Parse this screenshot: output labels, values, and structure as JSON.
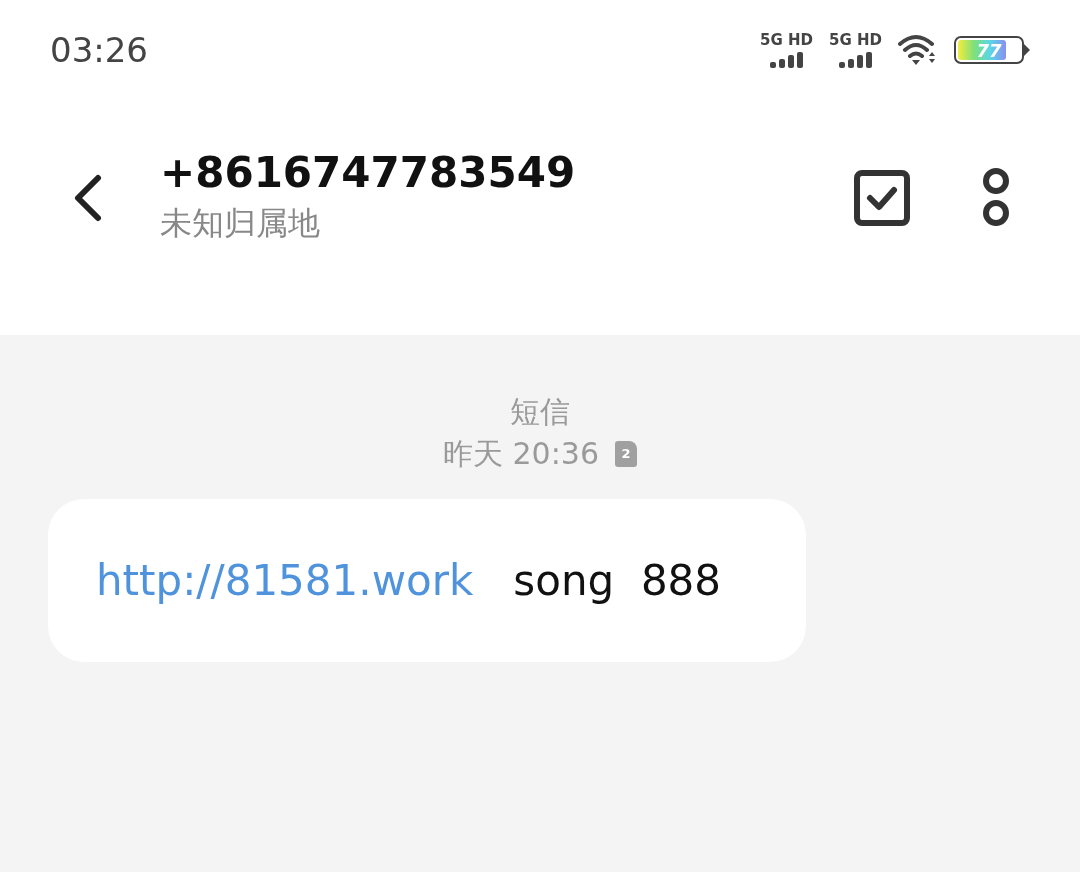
{
  "status_bar": {
    "time": "03:26",
    "networks": [
      "5G HD",
      "5G HD"
    ],
    "battery": {
      "reading": "77",
      "level": 0.77
    }
  },
  "header": {
    "title": "+8616747783549",
    "subtitle": "未知归属地"
  },
  "conversation": {
    "channel": "短信",
    "timestamp": "昨天 20:36",
    "sim": "2",
    "messages": [
      {
        "link": "http://81581.work",
        "text": "song  888"
      }
    ]
  }
}
